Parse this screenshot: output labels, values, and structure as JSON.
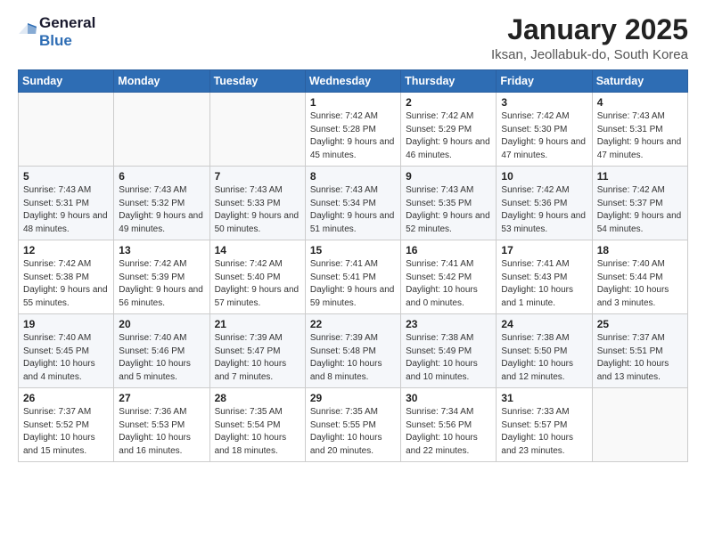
{
  "logo": {
    "line1": "General",
    "line2": "Blue"
  },
  "title": "January 2025",
  "subtitle": "Iksan, Jeollabuk-do, South Korea",
  "weekdays": [
    "Sunday",
    "Monday",
    "Tuesday",
    "Wednesday",
    "Thursday",
    "Friday",
    "Saturday"
  ],
  "weeks": [
    [
      {
        "day": "",
        "info": ""
      },
      {
        "day": "",
        "info": ""
      },
      {
        "day": "",
        "info": ""
      },
      {
        "day": "1",
        "info": "Sunrise: 7:42 AM\nSunset: 5:28 PM\nDaylight: 9 hours and 45 minutes."
      },
      {
        "day": "2",
        "info": "Sunrise: 7:42 AM\nSunset: 5:29 PM\nDaylight: 9 hours and 46 minutes."
      },
      {
        "day": "3",
        "info": "Sunrise: 7:42 AM\nSunset: 5:30 PM\nDaylight: 9 hours and 47 minutes."
      },
      {
        "day": "4",
        "info": "Sunrise: 7:43 AM\nSunset: 5:31 PM\nDaylight: 9 hours and 47 minutes."
      }
    ],
    [
      {
        "day": "5",
        "info": "Sunrise: 7:43 AM\nSunset: 5:31 PM\nDaylight: 9 hours and 48 minutes."
      },
      {
        "day": "6",
        "info": "Sunrise: 7:43 AM\nSunset: 5:32 PM\nDaylight: 9 hours and 49 minutes."
      },
      {
        "day": "7",
        "info": "Sunrise: 7:43 AM\nSunset: 5:33 PM\nDaylight: 9 hours and 50 minutes."
      },
      {
        "day": "8",
        "info": "Sunrise: 7:43 AM\nSunset: 5:34 PM\nDaylight: 9 hours and 51 minutes."
      },
      {
        "day": "9",
        "info": "Sunrise: 7:43 AM\nSunset: 5:35 PM\nDaylight: 9 hours and 52 minutes."
      },
      {
        "day": "10",
        "info": "Sunrise: 7:42 AM\nSunset: 5:36 PM\nDaylight: 9 hours and 53 minutes."
      },
      {
        "day": "11",
        "info": "Sunrise: 7:42 AM\nSunset: 5:37 PM\nDaylight: 9 hours and 54 minutes."
      }
    ],
    [
      {
        "day": "12",
        "info": "Sunrise: 7:42 AM\nSunset: 5:38 PM\nDaylight: 9 hours and 55 minutes."
      },
      {
        "day": "13",
        "info": "Sunrise: 7:42 AM\nSunset: 5:39 PM\nDaylight: 9 hours and 56 minutes."
      },
      {
        "day": "14",
        "info": "Sunrise: 7:42 AM\nSunset: 5:40 PM\nDaylight: 9 hours and 57 minutes."
      },
      {
        "day": "15",
        "info": "Sunrise: 7:41 AM\nSunset: 5:41 PM\nDaylight: 9 hours and 59 minutes."
      },
      {
        "day": "16",
        "info": "Sunrise: 7:41 AM\nSunset: 5:42 PM\nDaylight: 10 hours and 0 minutes."
      },
      {
        "day": "17",
        "info": "Sunrise: 7:41 AM\nSunset: 5:43 PM\nDaylight: 10 hours and 1 minute."
      },
      {
        "day": "18",
        "info": "Sunrise: 7:40 AM\nSunset: 5:44 PM\nDaylight: 10 hours and 3 minutes."
      }
    ],
    [
      {
        "day": "19",
        "info": "Sunrise: 7:40 AM\nSunset: 5:45 PM\nDaylight: 10 hours and 4 minutes."
      },
      {
        "day": "20",
        "info": "Sunrise: 7:40 AM\nSunset: 5:46 PM\nDaylight: 10 hours and 5 minutes."
      },
      {
        "day": "21",
        "info": "Sunrise: 7:39 AM\nSunset: 5:47 PM\nDaylight: 10 hours and 7 minutes."
      },
      {
        "day": "22",
        "info": "Sunrise: 7:39 AM\nSunset: 5:48 PM\nDaylight: 10 hours and 8 minutes."
      },
      {
        "day": "23",
        "info": "Sunrise: 7:38 AM\nSunset: 5:49 PM\nDaylight: 10 hours and 10 minutes."
      },
      {
        "day": "24",
        "info": "Sunrise: 7:38 AM\nSunset: 5:50 PM\nDaylight: 10 hours and 12 minutes."
      },
      {
        "day": "25",
        "info": "Sunrise: 7:37 AM\nSunset: 5:51 PM\nDaylight: 10 hours and 13 minutes."
      }
    ],
    [
      {
        "day": "26",
        "info": "Sunrise: 7:37 AM\nSunset: 5:52 PM\nDaylight: 10 hours and 15 minutes."
      },
      {
        "day": "27",
        "info": "Sunrise: 7:36 AM\nSunset: 5:53 PM\nDaylight: 10 hours and 16 minutes."
      },
      {
        "day": "28",
        "info": "Sunrise: 7:35 AM\nSunset: 5:54 PM\nDaylight: 10 hours and 18 minutes."
      },
      {
        "day": "29",
        "info": "Sunrise: 7:35 AM\nSunset: 5:55 PM\nDaylight: 10 hours and 20 minutes."
      },
      {
        "day": "30",
        "info": "Sunrise: 7:34 AM\nSunset: 5:56 PM\nDaylight: 10 hours and 22 minutes."
      },
      {
        "day": "31",
        "info": "Sunrise: 7:33 AM\nSunset: 5:57 PM\nDaylight: 10 hours and 23 minutes."
      },
      {
        "day": "",
        "info": ""
      }
    ]
  ]
}
